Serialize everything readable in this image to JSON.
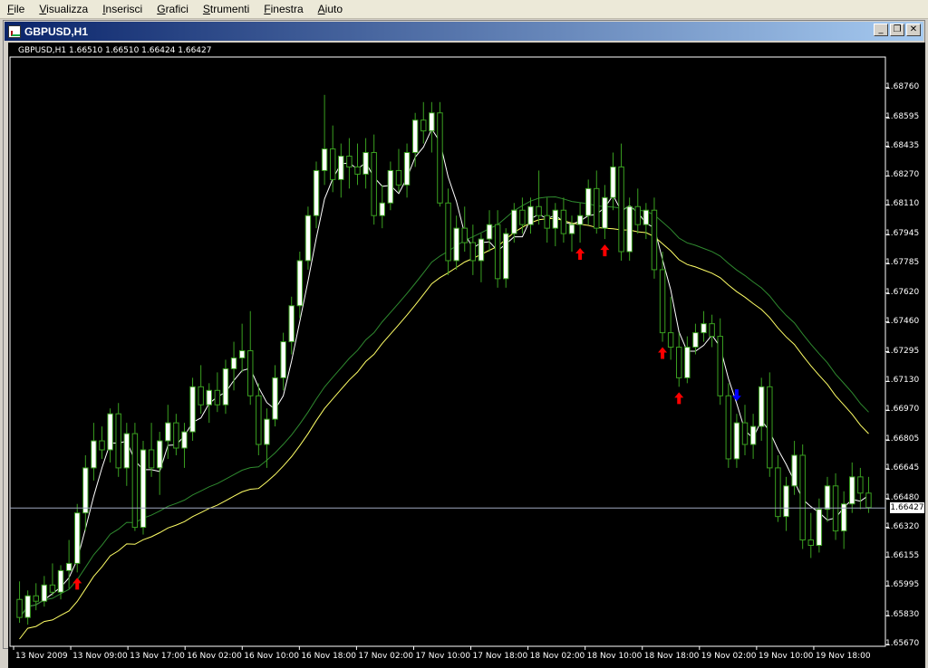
{
  "menu": [
    "File",
    "Visualizza",
    "Inserisci",
    "Grafici",
    "Strumenti",
    "Finestra",
    "Aiuto"
  ],
  "window": {
    "title": "GBPUSD,H1",
    "buttons": {
      "minimize": "_",
      "restore": "❐",
      "close": "✕"
    }
  },
  "chart": {
    "symbol_info": "GBPUSD,H1  1.66510 1.66510 1.66424 1.66427",
    "current_price": "1.66427",
    "price_axis": [
      "1.68760",
      "1.68595",
      "1.68435",
      "1.68270",
      "1.68110",
      "1.67945",
      "1.67785",
      "1.67620",
      "1.67460",
      "1.67295",
      "1.67130",
      "1.66970",
      "1.66805",
      "1.66645",
      "1.66480",
      "1.66320",
      "1.66155",
      "1.65995",
      "1.65830",
      "1.65670"
    ],
    "time_axis": [
      "13 Nov 2009",
      "13 Nov 09:00",
      "13 Nov 17:00",
      "16 Nov 02:00",
      "16 Nov 10:00",
      "16 Nov 18:00",
      "17 Nov 02:00",
      "17 Nov 10:00",
      "17 Nov 18:00",
      "18 Nov 02:00",
      "18 Nov 10:00",
      "18 Nov 18:00",
      "19 Nov 02:00",
      "19 Nov 10:00",
      "19 Nov 18:00"
    ],
    "colors": {
      "bull": "#ffffff",
      "bear": "#000000",
      "wick": "#3aa020",
      "fast_ma": "#ffffff",
      "mid_ma": "#ffff66",
      "slow_ma": "#2f8a2f",
      "buy_arrow": "#ff0000",
      "sell_arrow": "#0000ff"
    }
  },
  "chart_data": {
    "type": "candlestick",
    "ylim": [
      1.6567,
      1.6892
    ],
    "candles": [
      [
        1.6592,
        1.6602,
        1.6579,
        1.6582
      ],
      [
        1.6582,
        1.6597,
        1.6578,
        1.6594
      ],
      [
        1.6594,
        1.6601,
        1.6586,
        1.6591
      ],
      [
        1.6591,
        1.6605,
        1.6588,
        1.66
      ],
      [
        1.66,
        1.6612,
        1.6594,
        1.6596
      ],
      [
        1.6596,
        1.6611,
        1.6592,
        1.6608
      ],
      [
        1.6608,
        1.6625,
        1.6598,
        1.6612
      ],
      [
        1.6612,
        1.6645,
        1.6607,
        1.664
      ],
      [
        1.664,
        1.6672,
        1.663,
        1.6665
      ],
      [
        1.6665,
        1.669,
        1.6658,
        1.668
      ],
      [
        1.668,
        1.6688,
        1.667,
        1.6675
      ],
      [
        1.6675,
        1.6698,
        1.6668,
        1.6695
      ],
      [
        1.6695,
        1.6701,
        1.666,
        1.6665
      ],
      [
        1.6665,
        1.669,
        1.6655,
        1.6684
      ],
      [
        1.6684,
        1.669,
        1.663,
        1.6632
      ],
      [
        1.6632,
        1.668,
        1.6628,
        1.6675
      ],
      [
        1.6675,
        1.669,
        1.666,
        1.6665
      ],
      [
        1.6665,
        1.6685,
        1.665,
        1.668
      ],
      [
        1.668,
        1.67,
        1.667,
        1.669
      ],
      [
        1.669,
        1.6695,
        1.6672,
        1.6676
      ],
      [
        1.6676,
        1.669,
        1.6665,
        1.6685
      ],
      [
        1.6685,
        1.6715,
        1.668,
        1.671
      ],
      [
        1.671,
        1.6722,
        1.6695,
        1.67
      ],
      [
        1.67,
        1.6712,
        1.669,
        1.6708
      ],
      [
        1.6708,
        1.6718,
        1.6696,
        1.67
      ],
      [
        1.67,
        1.6725,
        1.6695,
        1.672
      ],
      [
        1.672,
        1.6735,
        1.6708,
        1.6726
      ],
      [
        1.6726,
        1.6745,
        1.6718,
        1.673
      ],
      [
        1.673,
        1.6752,
        1.67,
        1.6705
      ],
      [
        1.6705,
        1.6712,
        1.6672,
        1.6678
      ],
      [
        1.6678,
        1.6698,
        1.6665,
        1.6692
      ],
      [
        1.6692,
        1.6722,
        1.6688,
        1.6715
      ],
      [
        1.6715,
        1.674,
        1.6708,
        1.6735
      ],
      [
        1.6735,
        1.676,
        1.6728,
        1.6755
      ],
      [
        1.6755,
        1.6785,
        1.6748,
        1.678
      ],
      [
        1.678,
        1.681,
        1.6775,
        1.6805
      ],
      [
        1.6805,
        1.6835,
        1.6798,
        1.683
      ],
      [
        1.683,
        1.6872,
        1.6822,
        1.6842
      ],
      [
        1.6842,
        1.6855,
        1.6818,
        1.6825
      ],
      [
        1.6825,
        1.6845,
        1.6815,
        1.6838
      ],
      [
        1.6838,
        1.6848,
        1.682,
        1.6832
      ],
      [
        1.6832,
        1.6845,
        1.6822,
        1.6828
      ],
      [
        1.6828,
        1.6848,
        1.682,
        1.684
      ],
      [
        1.684,
        1.685,
        1.68,
        1.6805
      ],
      [
        1.6805,
        1.6822,
        1.6798,
        1.6812
      ],
      [
        1.6812,
        1.6835,
        1.6808,
        1.683
      ],
      [
        1.683,
        1.6842,
        1.6818,
        1.6822
      ],
      [
        1.6822,
        1.6845,
        1.6815,
        1.684
      ],
      [
        1.684,
        1.6862,
        1.6832,
        1.6858
      ],
      [
        1.6858,
        1.6868,
        1.6845,
        1.6852
      ],
      [
        1.6852,
        1.6868,
        1.684,
        1.6862
      ],
      [
        1.6862,
        1.6868,
        1.681,
        1.6812
      ],
      [
        1.6812,
        1.682,
        1.6772,
        1.678
      ],
      [
        1.678,
        1.6805,
        1.6775,
        1.6798
      ],
      [
        1.6798,
        1.681,
        1.6785,
        1.679
      ],
      [
        1.679,
        1.68,
        1.6772,
        1.678
      ],
      [
        1.678,
        1.6795,
        1.6768,
        1.6792
      ],
      [
        1.6792,
        1.6808,
        1.6785,
        1.68
      ],
      [
        1.68,
        1.6808,
        1.6765,
        1.677
      ],
      [
        1.677,
        1.6798,
        1.6765,
        1.6795
      ],
      [
        1.6795,
        1.6812,
        1.679,
        1.6808
      ],
      [
        1.6808,
        1.6815,
        1.6795,
        1.68
      ],
      [
        1.68,
        1.6815,
        1.6795,
        1.681
      ],
      [
        1.681,
        1.683,
        1.68,
        1.6805
      ],
      [
        1.6805,
        1.6815,
        1.679,
        1.6798
      ],
      [
        1.6798,
        1.6812,
        1.6788,
        1.6808
      ],
      [
        1.6808,
        1.6815,
        1.679,
        1.6795
      ],
      [
        1.6795,
        1.6805,
        1.6785,
        1.68
      ],
      [
        1.68,
        1.6812,
        1.679,
        1.6805
      ],
      [
        1.6805,
        1.6825,
        1.68,
        1.682
      ],
      [
        1.682,
        1.683,
        1.6795,
        1.6798
      ],
      [
        1.6798,
        1.6822,
        1.6792,
        1.6815
      ],
      [
        1.6815,
        1.684,
        1.6808,
        1.6832
      ],
      [
        1.6832,
        1.6845,
        1.678,
        1.6785
      ],
      [
        1.6785,
        1.6815,
        1.678,
        1.681
      ],
      [
        1.681,
        1.682,
        1.6795,
        1.68
      ],
      [
        1.68,
        1.6812,
        1.6792,
        1.6808
      ],
      [
        1.6808,
        1.6815,
        1.677,
        1.6775
      ],
      [
        1.6775,
        1.6785,
        1.6735,
        1.674
      ],
      [
        1.674,
        1.676,
        1.6725,
        1.6732
      ],
      [
        1.6732,
        1.674,
        1.671,
        1.6715
      ],
      [
        1.6715,
        1.6738,
        1.6712,
        1.6732
      ],
      [
        1.6732,
        1.6745,
        1.6728,
        1.674
      ],
      [
        1.674,
        1.6752,
        1.6735,
        1.6745
      ],
      [
        1.6745,
        1.675,
        1.6732,
        1.6738
      ],
      [
        1.6738,
        1.6748,
        1.67,
        1.6705
      ],
      [
        1.6705,
        1.6712,
        1.6665,
        1.667
      ],
      [
        1.667,
        1.6695,
        1.6665,
        1.669
      ],
      [
        1.669,
        1.67,
        1.6672,
        1.6678
      ],
      [
        1.6678,
        1.6695,
        1.667,
        1.6688
      ],
      [
        1.6688,
        1.6715,
        1.668,
        1.671
      ],
      [
        1.671,
        1.6718,
        1.666,
        1.6665
      ],
      [
        1.6665,
        1.6672,
        1.6635,
        1.6638
      ],
      [
        1.6638,
        1.666,
        1.663,
        1.6655
      ],
      [
        1.6655,
        1.668,
        1.665,
        1.6672
      ],
      [
        1.6672,
        1.6678,
        1.662,
        1.6625
      ],
      [
        1.6625,
        1.664,
        1.6615,
        1.6622
      ],
      [
        1.6622,
        1.6648,
        1.6618,
        1.6642
      ],
      [
        1.6642,
        1.666,
        1.6635,
        1.6655
      ],
      [
        1.6655,
        1.6662,
        1.6625,
        1.663
      ],
      [
        1.663,
        1.6652,
        1.662,
        1.6645
      ],
      [
        1.6645,
        1.6668,
        1.664,
        1.666
      ],
      [
        1.666,
        1.6665,
        1.6642,
        1.6651
      ],
      [
        1.6651,
        1.666,
        1.664,
        1.6643
      ]
    ],
    "arrows": [
      {
        "type": "buy",
        "index": 7
      },
      {
        "type": "buy",
        "index": 68
      },
      {
        "type": "buy",
        "index": 71
      },
      {
        "type": "buy",
        "index": 78
      },
      {
        "type": "buy",
        "index": 80
      },
      {
        "type": "sell",
        "index": 87
      }
    ]
  }
}
